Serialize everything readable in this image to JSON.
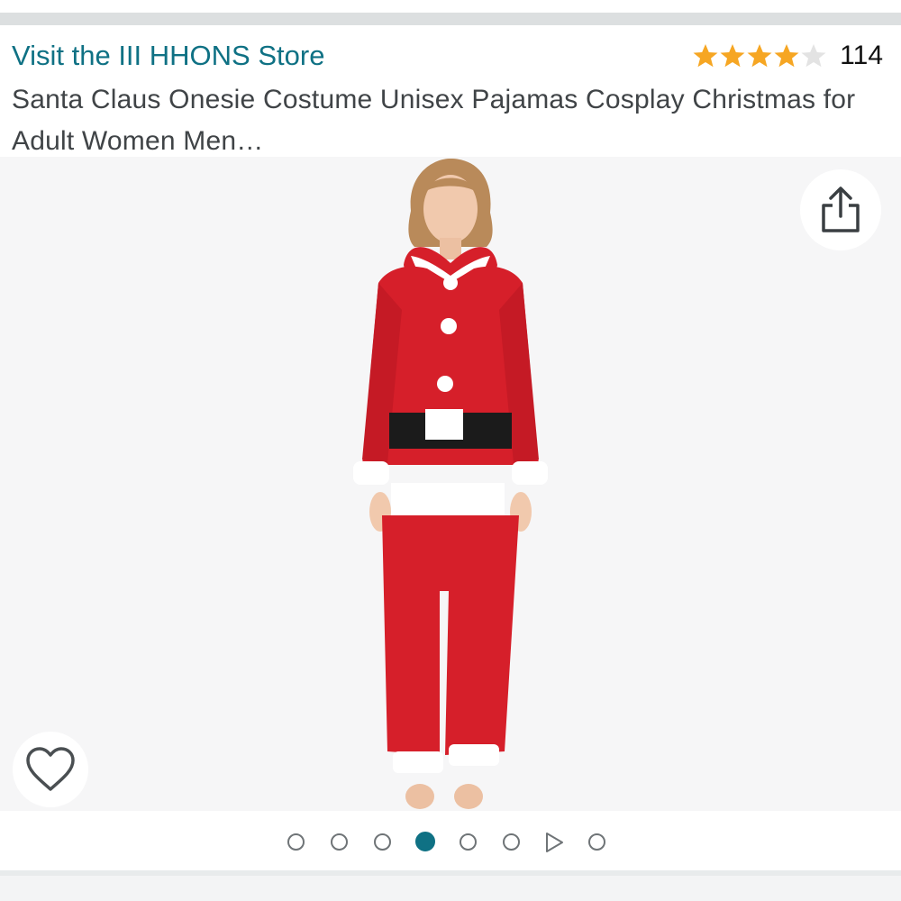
{
  "store": {
    "link_label": "Visit the III HHONS Store"
  },
  "rating": {
    "stars": 4,
    "max_stars": 5,
    "count": "114",
    "star_color": "#f6a623",
    "empty_star_color": "#e3e3e3"
  },
  "product": {
    "title": "Santa Claus Onesie Costume Unisex Pajamas Cosplay Christmas for Adult Women Men…"
  },
  "gallery": {
    "image_description_icon": "product-photo-santa-onesie",
    "total_slides": 8,
    "active_index": 3,
    "video_index": 6
  },
  "icons": {
    "share": "share-icon",
    "wishlist": "heart-icon",
    "video": "play-icon"
  },
  "colors": {
    "accent": "#0f7184",
    "suit_red": "#d61f2a",
    "fur_white": "#ffffff",
    "belt_black": "#1b1b1b"
  }
}
